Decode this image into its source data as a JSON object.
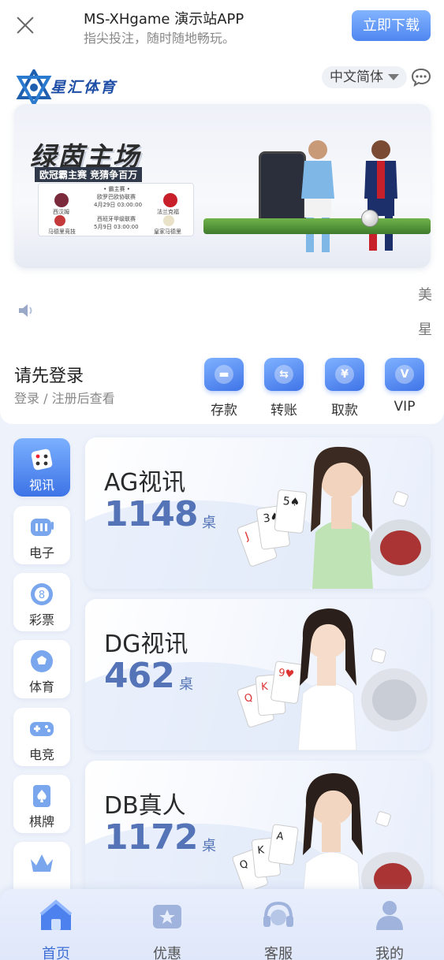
{
  "download_bar": {
    "title": "MS-XHgame 演示站APP",
    "subtitle": "指尖投注，随时随地畅玩。",
    "button": "立即下载"
  },
  "header": {
    "logo_text": "星汇体育",
    "language": "中文简体"
  },
  "banner": {
    "title": "绿茵主场",
    "subtitle": "欧冠霸主赛 竞猜争百万",
    "card_title": "• 霸主赛 •",
    "matches": [
      {
        "home": "西汉姆",
        "league": "欧罗巴欧协联赛",
        "time": "4月29日 03:00:00",
        "away": "法兰克福"
      },
      {
        "home": "马德里竞技",
        "league": "西班牙甲级联赛",
        "time": "5月9日 03:00:00",
        "away": "皇家马德里"
      }
    ]
  },
  "marquee": {
    "line1": "美",
    "line2": "星"
  },
  "login": {
    "title": "请先登录",
    "subtitle": "登录 / 注册后查看"
  },
  "quick_actions": [
    {
      "label": "存款",
      "icon": "deposit-icon"
    },
    {
      "label": "转账",
      "icon": "transfer-icon"
    },
    {
      "label": "取款",
      "icon": "withdraw-icon"
    },
    {
      "label": "VIP",
      "icon": "vip-icon"
    }
  ],
  "categories": [
    {
      "label": "视讯",
      "icon": "dice-icon",
      "active": true
    },
    {
      "label": "电子",
      "icon": "slot-machine-icon"
    },
    {
      "label": "彩票",
      "icon": "lottery-ball-icon"
    },
    {
      "label": "体育",
      "icon": "football-icon"
    },
    {
      "label": "电竞",
      "icon": "gamepad-icon"
    },
    {
      "label": "棋牌",
      "icon": "spade-card-icon"
    },
    {
      "label": "",
      "icon": "crown-icon"
    }
  ],
  "games": [
    {
      "name": "AG视讯",
      "count": "1148",
      "unit": "桌"
    },
    {
      "name": "DG视讯",
      "count": "462",
      "unit": "桌"
    },
    {
      "name": "DB真人",
      "count": "1172",
      "unit": "桌"
    }
  ],
  "bottom_nav": [
    {
      "label": "首页",
      "icon": "home-icon",
      "active": true
    },
    {
      "label": "优惠",
      "icon": "gift-ticket-icon"
    },
    {
      "label": "客服",
      "icon": "headset-icon"
    },
    {
      "label": "我的",
      "icon": "user-icon"
    }
  ],
  "colors": {
    "accent": "#3d73e6",
    "count_text": "#5574b8",
    "page_bg": "#eef2fb"
  }
}
